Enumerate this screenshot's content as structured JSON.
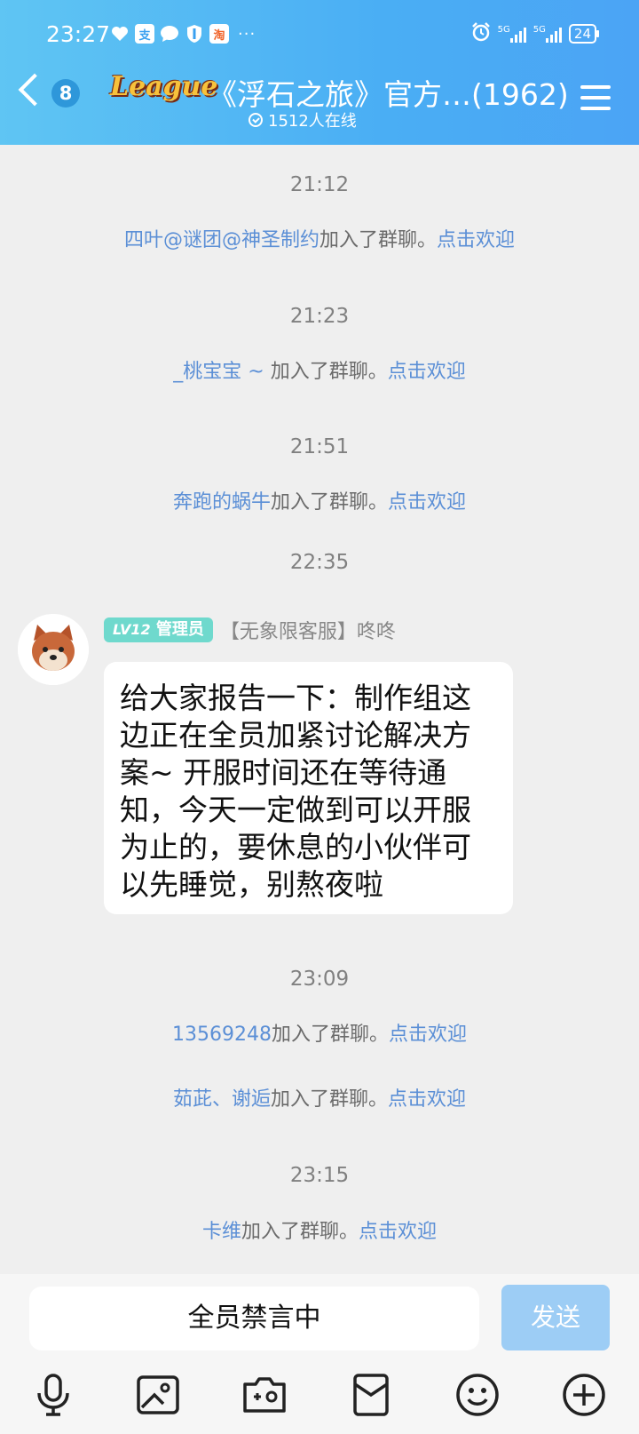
{
  "status_bar": {
    "time": "23:27",
    "more": "···",
    "signal1": "5G",
    "signal2": "5G",
    "battery": "24"
  },
  "header": {
    "unread_count": "8",
    "logo_text": "League",
    "title": "《浮石之旅》官方…(1962)",
    "online": "1512人在线"
  },
  "chat": {
    "events": [
      {
        "time": "21:12",
        "name": "四叶@谜团@神圣制约",
        "action": "加入了群聊。",
        "welcome": "点击欢迎"
      },
      {
        "time": "21:23",
        "name": "_桃宝宝 ~ ",
        "action": "加入了群聊。",
        "welcome": "点击欢迎"
      },
      {
        "time": "21:51",
        "name": "奔跑的蜗牛",
        "action": "加入了群聊。",
        "welcome": "点击欢迎"
      }
    ],
    "time_2235": "22:35",
    "message": {
      "level_badge": "LV12",
      "role": "管理员",
      "sender": "【无象限客服】咚咚",
      "text": "给大家报告一下：制作组这边正在全员加紧讨论解决方案~ 开服时间还在等待通知，今天一定做到可以开服为止的，要休息的小伙伴可以先睡觉，别熬夜啦"
    },
    "events2": [
      {
        "time": "23:09",
        "name": "13569248",
        "action": "加入了群聊。",
        "welcome": "点击欢迎"
      },
      {
        "name": "茹茈、谢逅",
        "action": "加入了群聊。",
        "welcome": "点击欢迎"
      },
      {
        "time": "23:15",
        "name": "卡维",
        "action": "加入了群聊。",
        "welcome": "点击欢迎"
      }
    ]
  },
  "input": {
    "muted_text": "全员禁言中",
    "send_label": "发送"
  },
  "toolbar_icons": [
    "microphone-icon",
    "image-icon",
    "camera-icon",
    "red-packet-icon",
    "emoji-icon",
    "plus-icon"
  ],
  "colors": {
    "header_start": "#5fc5f3",
    "header_end": "#4ba4f5",
    "link": "#5b8fd6",
    "badge": "#6fd9cd",
    "send_disabled": "#9dcdf5"
  }
}
